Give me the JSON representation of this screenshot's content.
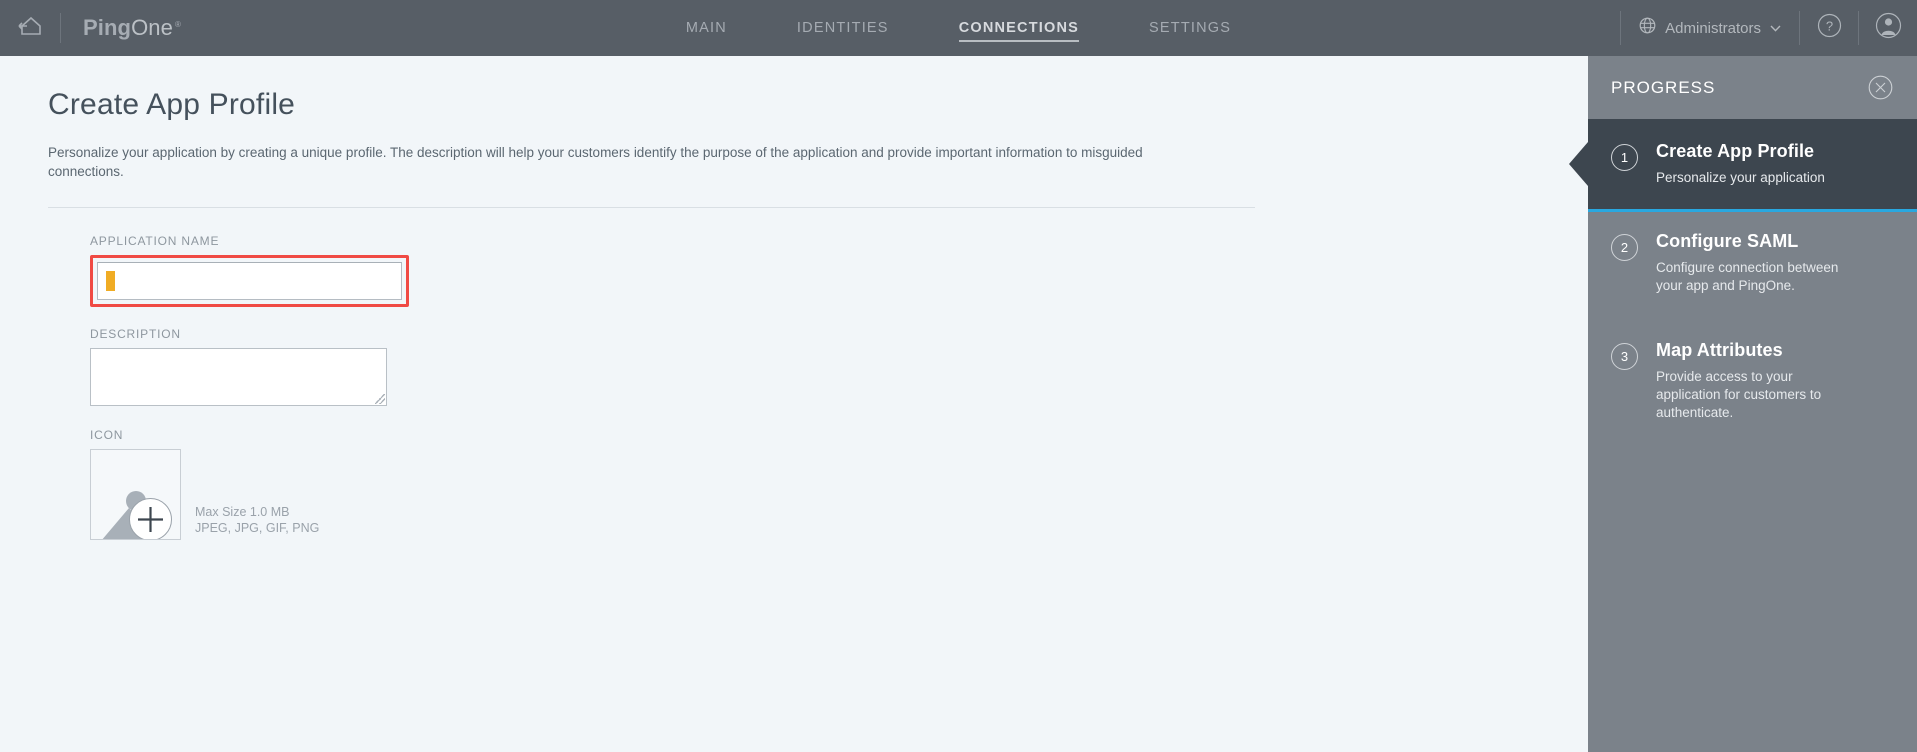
{
  "topnav": {
    "home_icon": "home-icon",
    "brand_ping": "Ping",
    "brand_one": "One",
    "brand_reg": "®",
    "items": [
      {
        "label": "MAIN",
        "active": false
      },
      {
        "label": "IDENTITIES",
        "active": false
      },
      {
        "label": "CONNECTIONS",
        "active": true
      },
      {
        "label": "SETTINGS",
        "active": false
      }
    ],
    "environment": {
      "icon": "globe-icon",
      "label": "Administrators",
      "caret": "⌄"
    },
    "help_icon": "help-circle-icon",
    "account_icon": "user-avatar-icon",
    "background": "#575e66"
  },
  "main": {
    "title": "Create App Profile",
    "description": "Personalize your application by creating a unique profile. The description will help your customers identify the purpose of the application and provide important information to misguided connections.",
    "fields": {
      "application_name": {
        "label": "APPLICATION NAME",
        "value": "",
        "highlight_color": "#f04a44",
        "caret_color": "#f0ac24"
      },
      "description": {
        "label": "DESCRIPTION",
        "value": ""
      },
      "icon": {
        "label": "ICON",
        "placeholder_icon": "image-placeholder-icon",
        "add_icon": "plus-circle-icon",
        "max_size": "Max Size 1.0 MB",
        "formats": "JPEG, JPG, GIF, PNG"
      }
    }
  },
  "progress": {
    "title": "PROGRESS",
    "close_icon": "close-circle-icon",
    "accent_color": "#29a8e0",
    "steps": [
      {
        "number": "1",
        "name": "Create App Profile",
        "description": "Personalize your application",
        "active": true
      },
      {
        "number": "2",
        "name": "Configure SAML",
        "description": "Configure connection between your app and PingOne.",
        "active": false
      },
      {
        "number": "3",
        "name": "Map Attributes",
        "description": "Provide access to your application for customers to authenticate.",
        "active": false
      }
    ]
  }
}
